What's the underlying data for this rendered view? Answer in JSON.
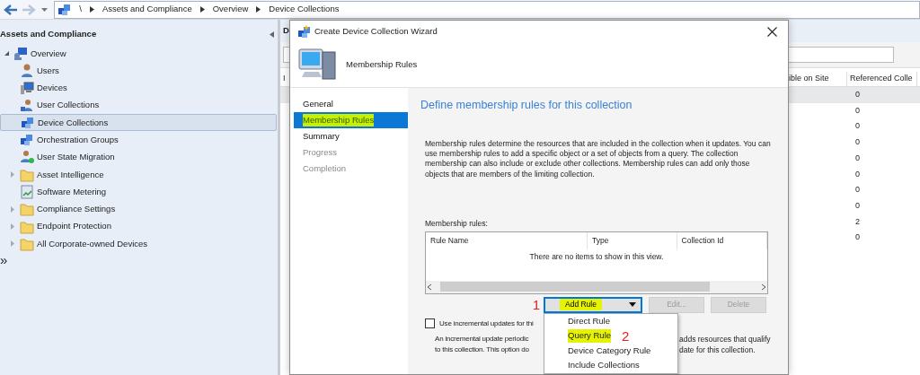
{
  "toolbar": {
    "back_enabled": true,
    "forward_enabled": false,
    "address": {
      "root": "\\",
      "crumbs": [
        "Assets and Compliance",
        "Overview",
        "Device Collections"
      ]
    }
  },
  "navigation_pane": {
    "title": "Assets and Compliance",
    "tree": [
      {
        "label": "Overview",
        "kind": "overview",
        "expanded": true,
        "selected": false,
        "children": [
          {
            "label": "Users",
            "kind": "user",
            "selected": false
          },
          {
            "label": "Devices",
            "kind": "devices",
            "selected": false
          },
          {
            "label": "User Collections",
            "kind": "user-collection",
            "selected": false
          },
          {
            "label": "Device Collections",
            "kind": "device-collection",
            "selected": true
          },
          {
            "label": "Orchestration Groups",
            "kind": "device-collection",
            "selected": false
          },
          {
            "label": "User State Migration",
            "kind": "user-state",
            "selected": false
          },
          {
            "label": "Asset Intelligence",
            "kind": "folder",
            "expanded": false,
            "selected": false
          },
          {
            "label": "Software Metering",
            "kind": "metering",
            "selected": false
          },
          {
            "label": "Compliance Settings",
            "kind": "folder",
            "expanded": false,
            "selected": false
          },
          {
            "label": "Endpoint Protection",
            "kind": "folder",
            "expanded": false,
            "selected": false
          },
          {
            "label": "All Corporate-owned Devices",
            "kind": "folder",
            "expanded": false,
            "selected": false
          }
        ]
      }
    ],
    "more": "»"
  },
  "content_pane": {
    "title": "D",
    "table": {
      "columns": [
        "I",
        "ible on Site",
        "Referenced Colle"
      ],
      "rows": [
        {
          "selected": true,
          "column_3": "0"
        },
        {
          "selected": false,
          "column_3": "0"
        },
        {
          "selected": false,
          "column_3": "0"
        },
        {
          "selected": false,
          "column_3": "0"
        },
        {
          "selected": false,
          "column_3": "0"
        },
        {
          "selected": false,
          "column_3": "0"
        },
        {
          "selected": false,
          "column_3": "0"
        },
        {
          "selected": false,
          "column_3": "0"
        },
        {
          "selected": false,
          "column_3": "2"
        },
        {
          "selected": false,
          "column_3": "0"
        }
      ]
    }
  },
  "wizard": {
    "title": "Create Device Collection Wizard",
    "header": "Membership Rules",
    "steps": [
      {
        "label": "General",
        "selected": false,
        "enabled": true,
        "highlighted": false
      },
      {
        "label": "Membership Rules",
        "selected": true,
        "enabled": true,
        "highlighted": true
      },
      {
        "label": "Summary",
        "selected": false,
        "enabled": true,
        "highlighted": false
      },
      {
        "label": "Progress",
        "selected": false,
        "enabled": false,
        "highlighted": false
      },
      {
        "label": "Completion",
        "selected": false,
        "enabled": false,
        "highlighted": false
      }
    ],
    "heading": "Define membership rules for this collection",
    "description": "Membership rules determine the resources that are included in the collection when it updates. You can use membership rules to add a specific object or a set of objects from a query. The collection membership can also include or exclude other collections. Membership rules can add only those objects that are members of the limiting collection.",
    "rules_label": "Membership rules:",
    "rules_list": {
      "columns": [
        "Rule Name",
        "Type",
        "Collection Id"
      ],
      "empty_message": "There are no items to show in this view."
    },
    "buttons": [
      {
        "label": "Add Rule",
        "kind": "split",
        "disabled": false,
        "focused": true,
        "highlighted": true,
        "annotation": "1"
      },
      {
        "label": "Edit...",
        "kind": "plain",
        "disabled": true,
        "focused": false,
        "highlighted": false
      },
      {
        "label": "Delete",
        "kind": "plain",
        "disabled": true,
        "focused": false,
        "highlighted": false
      }
    ],
    "incremental": {
      "checked": false,
      "label": "Use incremental updates for thi"
    },
    "note": {
      "left": [
        "An incremental update periodic",
        "to this collection. This option do"
      ],
      "right": [
        "adds resources that qualify",
        "date for this collection."
      ]
    },
    "menu": [
      {
        "label": "Direct Rule",
        "highlighted": false
      },
      {
        "label": "Query Rule",
        "highlighted": true,
        "annotation": "2"
      },
      {
        "label": "Device Category Rule",
        "highlighted": false
      },
      {
        "label": "Include Collections",
        "highlighted": false
      }
    ]
  }
}
